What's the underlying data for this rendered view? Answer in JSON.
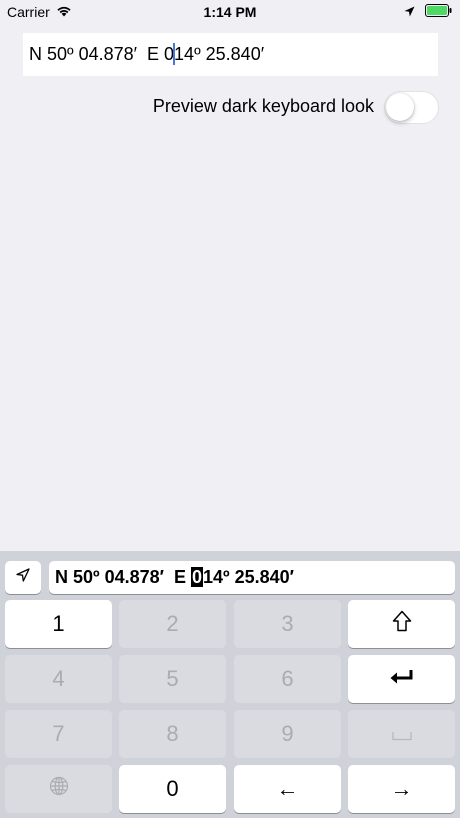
{
  "status_bar": {
    "carrier": "Carrier",
    "time": "1:14 PM"
  },
  "coordinate_field": {
    "text_before_caret": "N 50º 04.878′  E 0",
    "text_after_caret": "14º 25.840′"
  },
  "dark_keyboard_toggle": {
    "label": "Preview dark keyboard look",
    "on": false
  },
  "keyboard": {
    "location_icon": "location-arrow-icon",
    "preview": {
      "before_selection": "N 50º 04.878′  E ",
      "selected": "0",
      "after_selection": "14º 25.840′"
    },
    "keys": [
      {
        "label": "1",
        "enabled": true
      },
      {
        "label": "2",
        "enabled": false
      },
      {
        "label": "3",
        "enabled": false
      },
      {
        "label": "",
        "icon": "shift-arrow-icon",
        "enabled": true
      },
      {
        "label": "4",
        "enabled": false
      },
      {
        "label": "5",
        "enabled": false
      },
      {
        "label": "6",
        "enabled": false
      },
      {
        "label": "",
        "icon": "return-icon",
        "enabled": true
      },
      {
        "label": "7",
        "enabled": false
      },
      {
        "label": "8",
        "enabled": false
      },
      {
        "label": "9",
        "enabled": false
      },
      {
        "label": "",
        "icon": "space-icon",
        "enabled": false
      },
      {
        "label": "",
        "icon": "globe-icon",
        "enabled": false
      },
      {
        "label": "0",
        "enabled": true
      },
      {
        "label": "←",
        "enabled": true
      },
      {
        "label": "→",
        "enabled": true
      }
    ]
  },
  "colors": {
    "background": "#efeff4",
    "keyboard_bg": "#cfd2d9",
    "caret": "#4a74d6",
    "battery": "#4cd964"
  }
}
